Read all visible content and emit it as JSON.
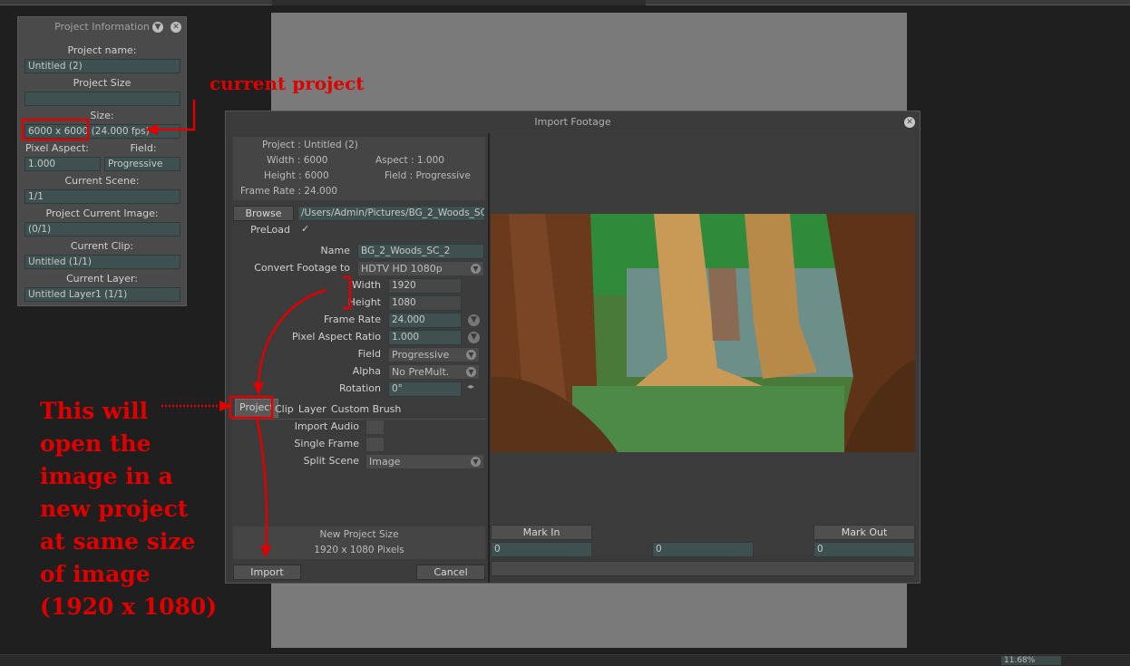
{
  "project_info": {
    "title": "Project Information",
    "project_name_label": "Project name:",
    "project_name": "Untitled (2)",
    "project_size_label": "Project Size",
    "project_size": "",
    "size_label": "Size:",
    "size_value": "6000 x 6000 (24.000 fps)",
    "pixel_aspect_label": "Pixel Aspect:",
    "pixel_aspect": "1.000",
    "field_label": "Field:",
    "field": "Progressive",
    "current_scene_label": "Current Scene:",
    "current_scene": "1/1",
    "current_image_label": "Project Current Image:",
    "current_image": "(0/1)",
    "current_clip_label": "Current Clip:",
    "current_clip": "Untitled (1/1)",
    "current_layer_label": "Current Layer:",
    "current_layer": "Untitled Layer1 (1/1)"
  },
  "dialog": {
    "title": "Import Footage",
    "info": {
      "project": "Project : Untitled (2)",
      "width": "Width : 6000",
      "aspect": "Aspect : 1.000",
      "height": "Height : 6000",
      "field": "Field : Progressive",
      "frame_rate": "Frame Rate : 24.000"
    },
    "browse_label": "Browse",
    "path": "/Users/Admin/Pictures/BG_2_Woods_SC",
    "preload_label": "PreLoad",
    "preload_check": "✓",
    "name_label": "Name",
    "name_value": "BG_2_Woods_SC_2",
    "convert_label": "Convert Footage to",
    "convert_value": "HDTV  HD 1080p",
    "width_label": "Width",
    "width_value": "1920",
    "height_label": "Height",
    "height_value": "1080",
    "frame_rate_label": "Frame Rate",
    "frame_rate_value": "24.000",
    "par_label": "Pixel Aspect Ratio",
    "par_value": "1.000",
    "field_label": "Field",
    "field_value": "Progressive",
    "alpha_label": "Alpha",
    "alpha_value": "No PreMult.",
    "rotation_label": "Rotation",
    "rotation_value": "0°",
    "tabs": [
      "Project",
      "Clip",
      "Layer",
      "Custom Brush"
    ],
    "import_audio_label": "Import Audio",
    "single_frame_label": "Single Frame",
    "split_scene_label": "Split Scene",
    "split_scene_value": "Image",
    "new_size_title": "New Project Size",
    "new_size_value": "1920 x 1080 Pixels",
    "import_label": "Import",
    "cancel_label": "Cancel",
    "mark_in_label": "Mark In",
    "mark_out_label": "Mark Out",
    "mark_in_value": "0",
    "mark_mid_value": "0",
    "mark_out_value": "0"
  },
  "status": {
    "zoom": "11.68%"
  },
  "annotations": {
    "current_project": "current project",
    "note_lines": [
      "This will",
      "open the",
      "image in a",
      "new project",
      "at same size",
      "of image",
      "(1920 x 1080)"
    ]
  },
  "colors": {
    "annotation_red": "#e00000",
    "field_bg": "#3e5050"
  }
}
